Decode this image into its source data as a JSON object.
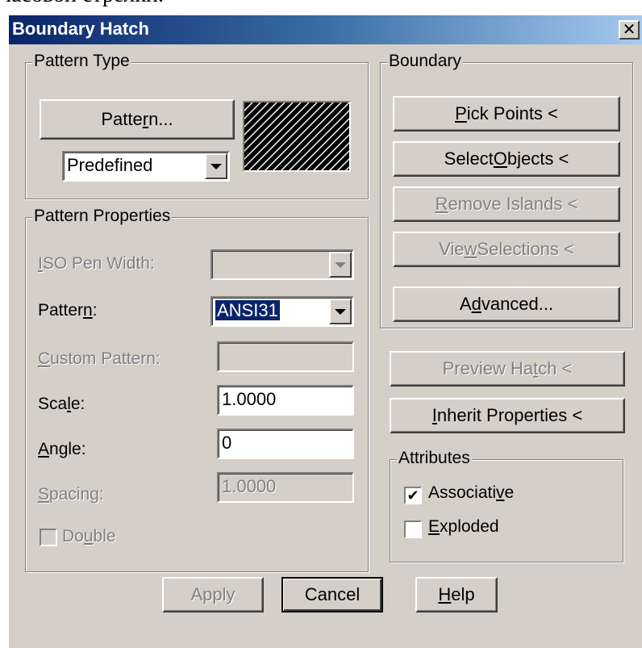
{
  "document": {
    "text": "часовой стрелки."
  },
  "window": {
    "title": "Boundary Hatch",
    "close_glyph": "✕"
  },
  "pattern_type": {
    "label": "Pattern Type",
    "pattern_button": {
      "before": "Patte",
      "mnemonic": "r",
      "after": "n..."
    },
    "type_combo": {
      "value": "Predefined"
    }
  },
  "pattern_properties": {
    "label": "Pattern Properties",
    "iso_pen_width": {
      "before": "",
      "mnemonic": "I",
      "after": "SO Pen Width:",
      "value": ""
    },
    "pattern": {
      "before": "Patter",
      "mnemonic": "n",
      "after": ":",
      "value": "ANSI31"
    },
    "custom_pattern": {
      "before": "",
      "mnemonic": "C",
      "after": "ustom Pattern:",
      "value": ""
    },
    "scale": {
      "before": "Sca",
      "mnemonic": "l",
      "after": "e:",
      "value": "1.0000"
    },
    "angle": {
      "before": "",
      "mnemonic": "A",
      "after": "ngle:",
      "value": "0"
    },
    "spacing": {
      "before": "",
      "mnemonic": "S",
      "after": "pacing:",
      "value": "1.0000"
    },
    "double": {
      "before": "Do",
      "mnemonic": "u",
      "after": "ble",
      "checked": false
    }
  },
  "boundary": {
    "label": "Boundary",
    "pick_points": {
      "before": "",
      "mnemonic": "P",
      "after": "ick Points <"
    },
    "select_objects": {
      "before": "Select ",
      "mnemonic": "O",
      "after": "bjects <"
    },
    "remove_islands": {
      "before": "",
      "mnemonic": "R",
      "after": "emove Islands <"
    },
    "view_selections": {
      "before": "Vie",
      "mnemonic": "w",
      "after": " Selections <"
    },
    "advanced": {
      "before": "A",
      "mnemonic": "d",
      "after": "vanced..."
    }
  },
  "preview_hatch": {
    "before": "Preview Ha",
    "mnemonic": "t",
    "after": "ch <"
  },
  "inherit_properties": {
    "before": "",
    "mnemonic": "I",
    "after": "nherit Properties <"
  },
  "attributes": {
    "label": "Attributes",
    "associative": {
      "before": "Associati",
      "mnemonic": "v",
      "after": "e",
      "checked": true,
      "check_glyph": "✔"
    },
    "exploded": {
      "before": "",
      "mnemonic": "E",
      "after": "xploded",
      "checked": false
    }
  },
  "footer": {
    "apply": {
      "before": "Apply",
      "mnemonic": "",
      "after": ""
    },
    "cancel": {
      "before": "Cancel",
      "mnemonic": "",
      "after": ""
    },
    "help": {
      "before": "",
      "mnemonic": "H",
      "after": "elp"
    }
  },
  "colors": {
    "title_start": "#0a246a",
    "title_end": "#a6caf0",
    "face": "#d4d0c8",
    "selection": "#0a246a"
  }
}
